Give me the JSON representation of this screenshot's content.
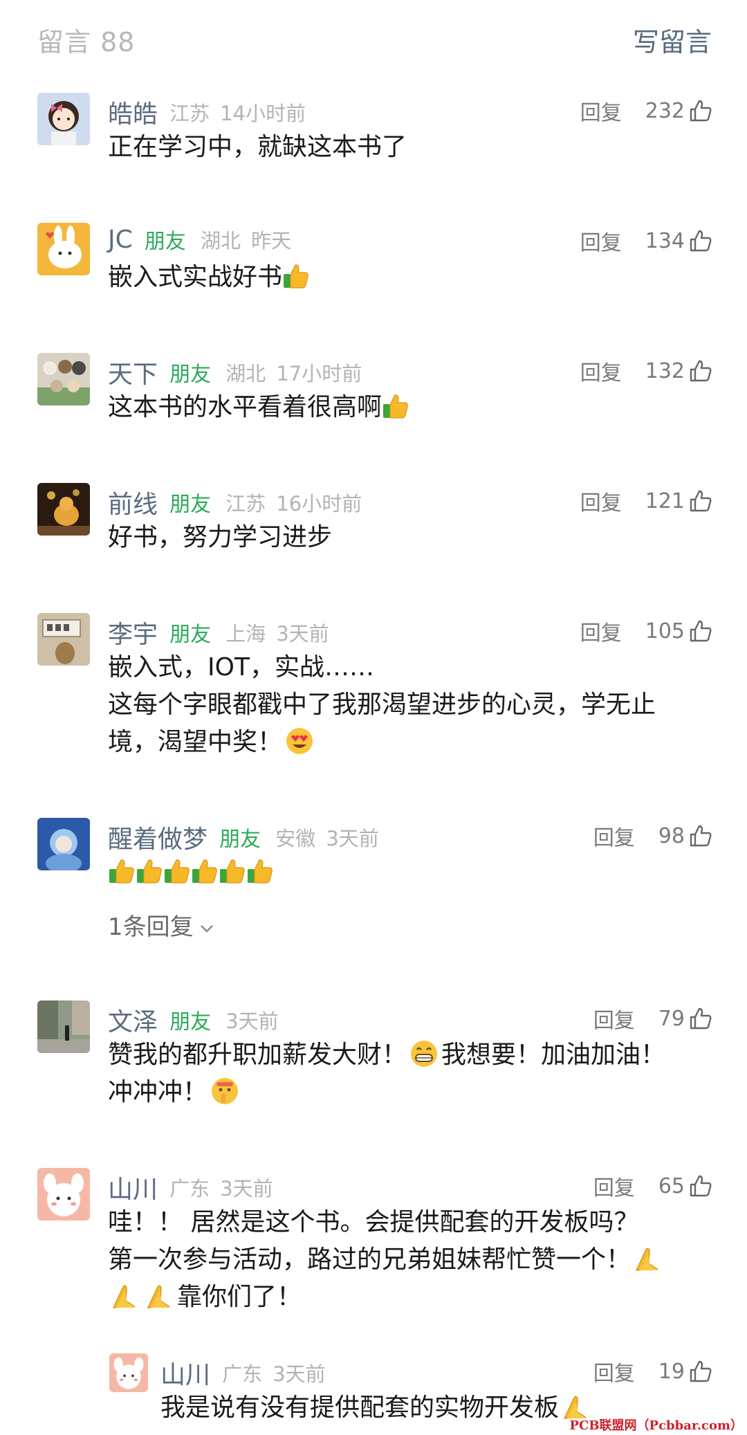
{
  "header": {
    "title": "留言 88",
    "write_label": "写留言"
  },
  "reply_label": "回复",
  "comments": [
    {
      "name": "皓皓",
      "friend": "",
      "location": "江苏",
      "time": "14小时前",
      "likes": "232",
      "lines": [
        "正在学习中，就缺这本书了"
      ]
    },
    {
      "name": "JC",
      "friend": "朋友",
      "location": "湖北",
      "time": "昨天",
      "likes": "134",
      "lines": [
        "嵌入式实战好书"
      ]
    },
    {
      "name": "天下",
      "friend": "朋友",
      "location": "湖北",
      "time": "17小时前",
      "likes": "132",
      "lines": [
        "这本书的水平看着很高啊"
      ]
    },
    {
      "name": "前线",
      "friend": "朋友",
      "location": "江苏",
      "time": "16小时前",
      "likes": "121",
      "lines": [
        "好书，努力学习进步"
      ]
    },
    {
      "name": "李宇",
      "friend": "朋友",
      "location": "上海",
      "time": "3天前",
      "likes": "105",
      "lines": [
        "嵌入式，IOT，实战……",
        "这每个字眼都戳中了我那渴望进步的心灵，学无止",
        "境，渴望中奖！"
      ]
    },
    {
      "name": "醒着做梦",
      "friend": "朋友",
      "location": "安徽",
      "time": "3天前",
      "likes": "98",
      "lines": [],
      "more_replies": "1条回复"
    },
    {
      "name": "文泽",
      "friend": "朋友",
      "location": "",
      "time": "3天前",
      "likes": "79",
      "lines": [
        "赞我的都升职加薪发大财！",
        "我想要！加油加油！",
        "冲冲冲！"
      ]
    },
    {
      "name": "山川",
      "friend": "",
      "location": "广东",
      "time": "3天前",
      "likes": "65",
      "lines": [
        "哇！！ 居然是这个书。会提供配套的开发板吗？",
        "第一次参与活动，路过的兄弟姐妹帮忙赞一个！",
        "靠你们了！"
      ]
    },
    {
      "name": "山川",
      "friend": "",
      "location": "广东",
      "time": "3天前",
      "likes": "19",
      "lines": [
        "我是说有没有提供配套的实物开发板"
      ]
    }
  ],
  "watermark": "PCB联盟网（Pcbbar.com）",
  "colors": {
    "name": "#5b6b80",
    "friend": "#2aab58",
    "muted": "#b3b3b3",
    "write": "#5a6a7e",
    "watermark": "#d0202a"
  },
  "icons": [
    "like-thumb-icon",
    "thumbs-up-emoji-icon",
    "heart-eyes-emoji-icon",
    "grin-emoji-icon",
    "shush-emoji-icon",
    "pray-hands-emoji-icon",
    "chevron-down-icon"
  ]
}
